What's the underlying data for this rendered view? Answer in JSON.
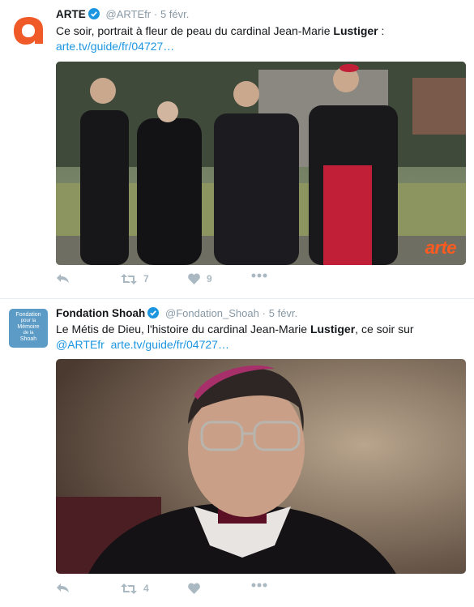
{
  "colors": {
    "link": "#1b95e0",
    "arte_orange": "#f05a28",
    "action_gray": "#aab8c2",
    "shoah_blue": "#5b9bc6"
  },
  "tweets": [
    {
      "avatar_icon": "arte-logo-icon",
      "name": "ARTE",
      "handle": "@ARTEfr",
      "separator": "·",
      "date": "5 févr.",
      "text_before": "Ce soir, portrait à fleur de peau du cardinal Jean-Marie ",
      "text_bold": "Lustiger",
      "text_after": " :",
      "link": "arte.tv/guide/fr/04727…",
      "media_watermark": "arte",
      "retweets": "7",
      "likes": "9"
    },
    {
      "avatar_text": {
        "line1": "Fondation",
        "line2": "pour la",
        "line3": "Mémoire",
        "line4": "de la",
        "line5": "Shoah"
      },
      "name": "Fondation Shoah",
      "handle": "@Fondation_Shoah",
      "separator": "·",
      "date": "5 févr.",
      "text_before": "Le Métis de Dieu, l'histoire du cardinal Jean-Marie ",
      "text_bold": "Lustiger",
      "text_after": ", ce soir sur",
      "mention": "@ARTEfr",
      "link": "arte.tv/guide/fr/04727…",
      "retweets": "4",
      "likes": ""
    }
  ]
}
